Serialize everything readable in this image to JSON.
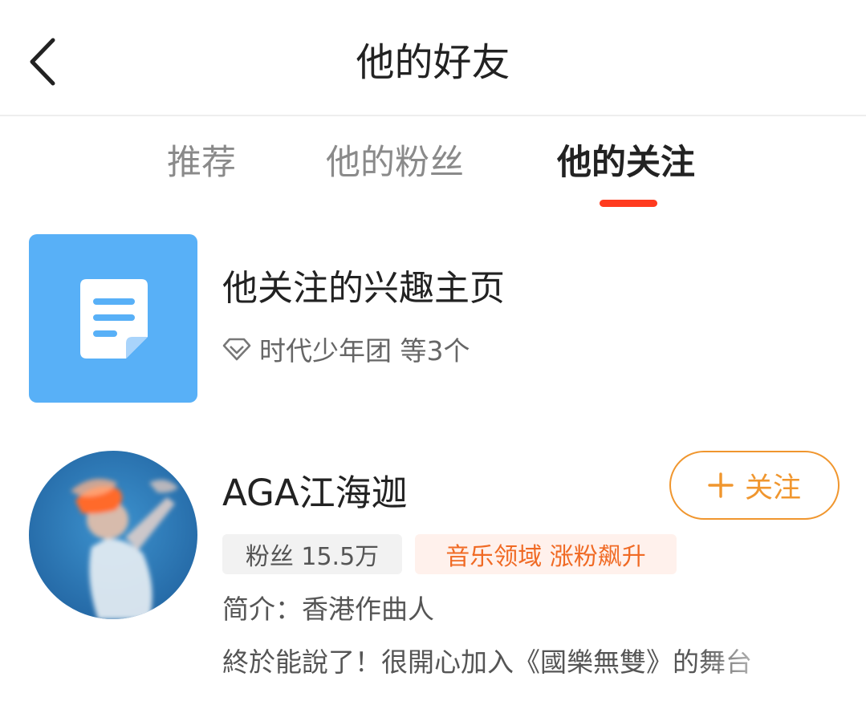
{
  "header": {
    "title": "他的好友",
    "back_icon": "chevron-left-icon"
  },
  "tabs": [
    {
      "label": "推荐",
      "active": false
    },
    {
      "label": "他的粉丝",
      "active": false
    },
    {
      "label": "他的关注",
      "active": true
    }
  ],
  "colors": {
    "accent_red": "#ff3b1f",
    "follow_orange": "#f0962e",
    "hot_badge_text": "#f06a24",
    "tile_blue": "#58b0f7"
  },
  "interest_pages": {
    "icon": "document-icon",
    "title": "他关注的兴趣主页",
    "sub_icon": "diamond-icon",
    "subtitle": "时代少年团 等3个"
  },
  "users": [
    {
      "name": "AGA江海迦",
      "follow_label": "关注",
      "follow_icon": "plus-icon",
      "fans_badge": "粉丝 15.5万",
      "hot_badge": "音乐领域 涨粉飙升",
      "bio": "简介：香港作曲人",
      "latest_post": "終於能說了！很開心加入《國樂無雙》的舞台"
    }
  ]
}
